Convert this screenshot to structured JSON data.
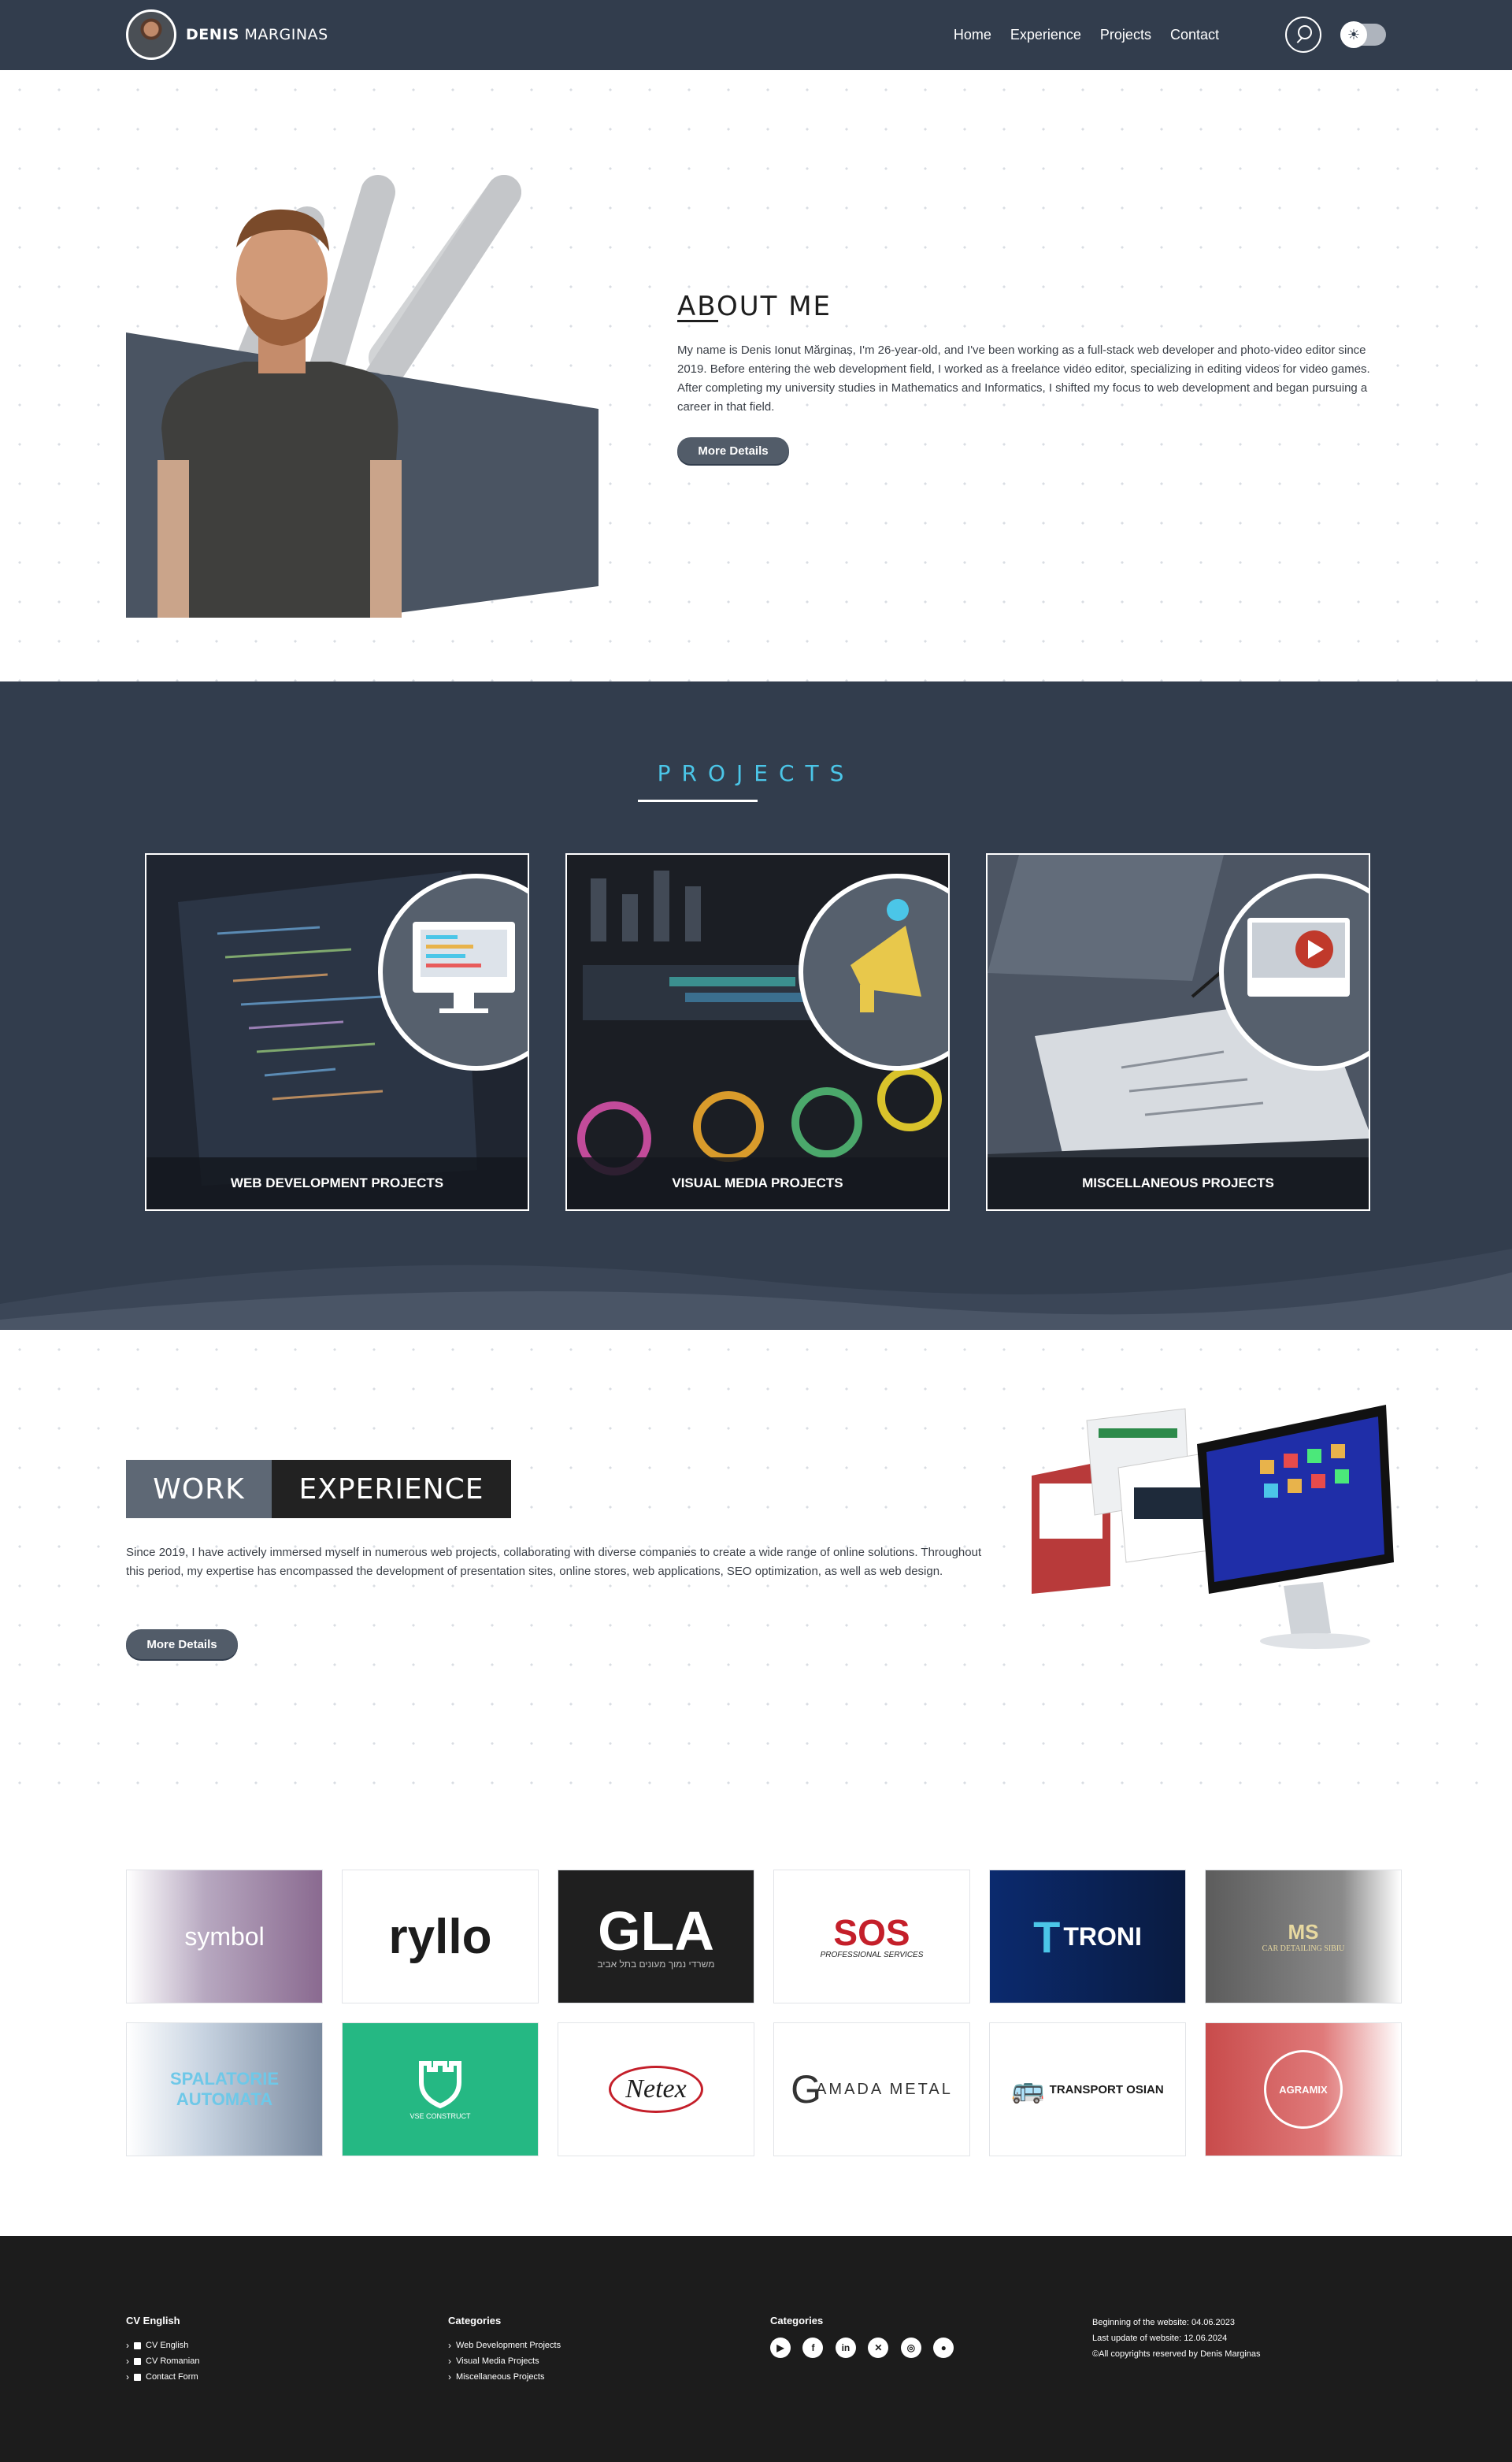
{
  "nav": {
    "brand_first": "Denis",
    "brand_last": "Marginas",
    "items": [
      "Home",
      "Experience",
      "Projects",
      "Contact"
    ],
    "theme_icon": "☀"
  },
  "about": {
    "title": "ABOUT ME",
    "text": "My name is Denis Ionut Mărginaș, I'm 26-year-old, and I've been working as a full-stack web developer and photo-video editor since 2019. Before entering the web development field, I worked as a freelance video editor, specializing in editing videos for video games. After completing my university studies in Mathematics and Informatics, I shifted my focus to web development and began pursuing a career in that field.",
    "button": "More Details"
  },
  "projects": {
    "title": "PROJECTS",
    "cards": [
      {
        "label": "WEB DEVELOPMENT PROJECTS"
      },
      {
        "label": "VISUAL MEDIA PROJECTS"
      },
      {
        "label": "MISCELLANEOUS PROJECTS"
      }
    ]
  },
  "work": {
    "title_part1": "WORK",
    "title_part2": "EXPERIENCE",
    "text": "Since 2019, I have actively immersed myself in numerous web projects, collaborating with diverse companies to create a wide range of online solutions. Throughout this period, my expertise has encompassed the development of presentation sites, online stores, web applications, SEO optimization, as well as web design.",
    "button": "More Details"
  },
  "logos": [
    {
      "name": "symbol",
      "text": "symbol"
    },
    {
      "name": "ryllo",
      "text": "ryllo"
    },
    {
      "name": "gla",
      "text": "GLA",
      "sub": "משרדי נמוך מעונים בתל אביב"
    },
    {
      "name": "sos",
      "text": "SOS",
      "sub": "PROFESSIONAL SERVICES"
    },
    {
      "name": "troni",
      "text": "TRONI"
    },
    {
      "name": "car-detailing",
      "text": "MS",
      "sub": "CAR DETAILING SIBIU"
    },
    {
      "name": "spalatorie",
      "text": "SPALATORIE AUTOMATA"
    },
    {
      "name": "vse",
      "text": "VSE CONSTRUCT"
    },
    {
      "name": "netex",
      "text": "Netex"
    },
    {
      "name": "amada",
      "text": "AMADA METAL"
    },
    {
      "name": "transport",
      "text": "TRANSPORT OSIAN"
    },
    {
      "name": "agramix",
      "text": "AGRAMIX"
    }
  ],
  "footer": {
    "col1": {
      "title": "CV English",
      "items": [
        "CV English",
        "CV Romanian",
        "Contact Form"
      ]
    },
    "col2": {
      "title": "Categories",
      "items": [
        "Web Development Projects",
        "Visual Media Projects",
        "Miscellaneous Projects"
      ]
    },
    "col3": {
      "title": "Categories",
      "socials": [
        "youtube-icon",
        "facebook-icon",
        "linkedin-icon",
        "x-icon",
        "instagram-icon",
        "github-icon"
      ]
    },
    "info": [
      "Beginning of the website: 04.06.2023",
      "Last update of website: 12.06.2024",
      "©All copyrights reserved by Denis Marginas"
    ]
  }
}
